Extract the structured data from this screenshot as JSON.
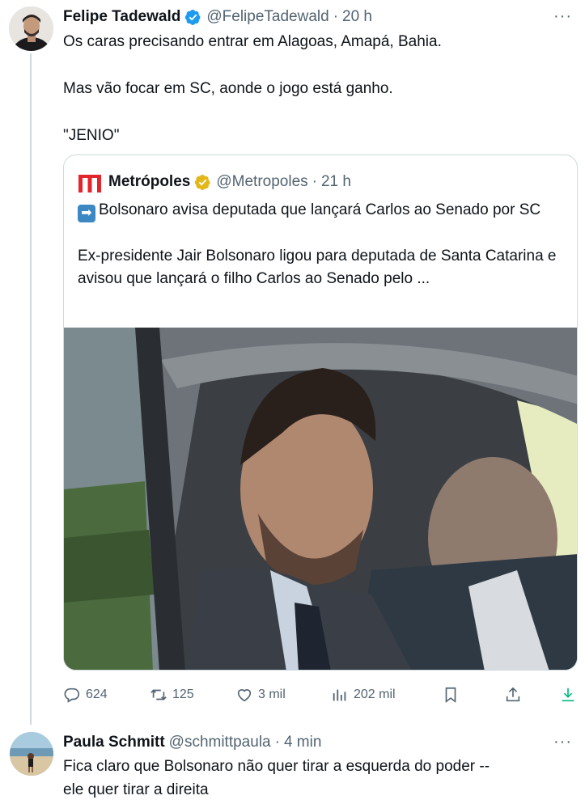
{
  "tweet": {
    "author_name": "Felipe Tadewald",
    "author_handle": "@FelipeTadewald",
    "separator": "·",
    "time": "20 h",
    "more": "···",
    "text": "Os caras precisando entrar em Alagoas, Amapá, Bahia.\n\nMas vão focar em SC, aonde o jogo está ganho.\n\n\"JENIO\""
  },
  "quoted": {
    "author_name": "Metrópoles",
    "author_handle": "@Metropoles",
    "separator": "·",
    "time": "21 h",
    "emoji": "➡",
    "headline": "Bolsonaro avisa deputada que lançará Carlos ao Senado por SC",
    "body": "Ex-presidente Jair Bolsonaro ligou para deputada de Santa Catarina e avisou que lançará o filho Carlos ao Senado pelo ..."
  },
  "actions": {
    "replies": "624",
    "retweets": "125",
    "likes": "3 mil",
    "views": "202 mil"
  },
  "reply": {
    "author_name": "Paula Schmitt",
    "author_handle": "@schmittpaula",
    "separator": "·",
    "time": "4 min",
    "more": "···",
    "text": "Fica claro que Bolsonaro não quer tirar a esquerda do poder  --\nele quer tirar a direita"
  },
  "colors": {
    "verified_blue": "#1d9bf0",
    "verified_gold": "#e2b719",
    "metropoles_red": "#e3262b",
    "secondary_text": "#536471",
    "download_green": "#00ba7c"
  },
  "icons": [
    "reply-icon",
    "retweet-icon",
    "like-icon",
    "views-icon",
    "bookmark-icon",
    "share-icon",
    "download-icon",
    "verified-badge-icon",
    "metropoles-logo"
  ]
}
